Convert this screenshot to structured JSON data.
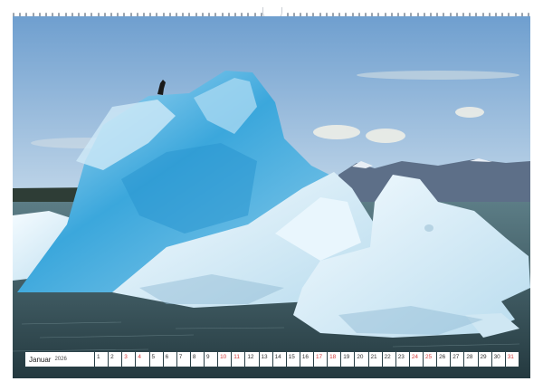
{
  "calendar": {
    "month": "Januar",
    "year": "2026",
    "days": [
      {
        "n": "1",
        "weekend": false
      },
      {
        "n": "2",
        "weekend": false
      },
      {
        "n": "3",
        "weekend": true
      },
      {
        "n": "4",
        "weekend": true
      },
      {
        "n": "5",
        "weekend": false
      },
      {
        "n": "6",
        "weekend": false
      },
      {
        "n": "7",
        "weekend": false
      },
      {
        "n": "8",
        "weekend": false
      },
      {
        "n": "9",
        "weekend": false
      },
      {
        "n": "10",
        "weekend": true
      },
      {
        "n": "11",
        "weekend": true
      },
      {
        "n": "12",
        "weekend": false
      },
      {
        "n": "13",
        "weekend": false
      },
      {
        "n": "14",
        "weekend": false
      },
      {
        "n": "15",
        "weekend": false
      },
      {
        "n": "16",
        "weekend": false
      },
      {
        "n": "17",
        "weekend": true
      },
      {
        "n": "18",
        "weekend": true
      },
      {
        "n": "19",
        "weekend": false
      },
      {
        "n": "20",
        "weekend": false
      },
      {
        "n": "21",
        "weekend": false
      },
      {
        "n": "22",
        "weekend": false
      },
      {
        "n": "23",
        "weekend": false
      },
      {
        "n": "24",
        "weekend": true
      },
      {
        "n": "25",
        "weekend": true
      },
      {
        "n": "26",
        "weekend": false
      },
      {
        "n": "27",
        "weekend": false
      },
      {
        "n": "28",
        "weekend": false
      },
      {
        "n": "29",
        "weekend": false
      },
      {
        "n": "30",
        "weekend": false
      },
      {
        "n": "31",
        "weekend": true
      }
    ]
  },
  "colors": {
    "sky_top": "#6f9fcf",
    "sky_bottom": "#bcd3e8",
    "ice_deep": "#2f9fd6",
    "ice_light": "#dcefff",
    "water": "#2f4a52",
    "weekend": "#d23c3c"
  }
}
